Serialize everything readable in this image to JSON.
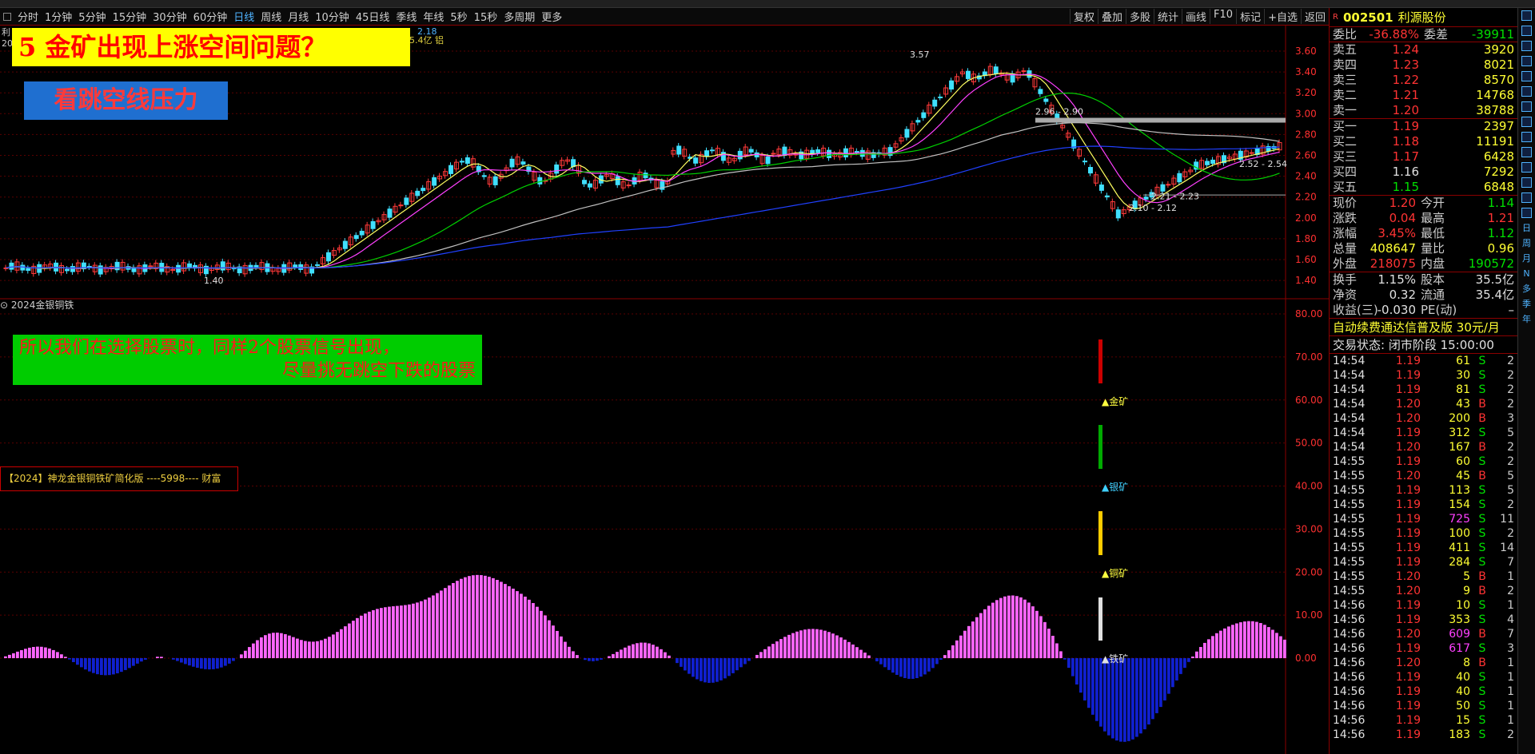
{
  "toolbar": {
    "items": [
      "分时",
      "1分钟",
      "5分钟",
      "15分钟",
      "30分钟",
      "60分钟",
      "日线",
      "周线",
      "月线",
      "10分钟",
      "45日线",
      "季线",
      "年线",
      "5秒",
      "15秒",
      "多周期",
      "更多"
    ],
    "active": "日线",
    "right": [
      "复权",
      "叠加",
      "多股",
      "统计",
      "画线",
      "F10",
      "标记",
      "+自选",
      "返回"
    ]
  },
  "chart": {
    "stock_short": "利",
    "date_short": "20",
    "price_ticks": [
      "3.60",
      "3.40",
      "3.20",
      "3.00",
      "2.80",
      "2.60",
      "2.40",
      "2.20",
      "2.00",
      "1.80",
      "1.60",
      "1.40"
    ],
    "annotations": [
      "3.57",
      "2.96 - 2.90",
      "2.52 - 2.54",
      "2.21 - 2.23",
      "2.10 - 2.12",
      "1.40"
    ],
    "ma_info": "5.4亿 铝",
    "ma_val": "2.18"
  },
  "overlays": {
    "title": "5 金矿出现上涨空间问题？",
    "gap": "看跳空线压力",
    "note_line1": "所以我们在选择股票时，同样2个股票信号出现，",
    "note_line2": "尽量挑无跳空下跌的股票"
  },
  "indicator": {
    "name": "2024金银铜铁",
    "label": "【2024】神龙金银铜铁矿简化版 ----5998---- 财富",
    "ticks": [
      "80.00",
      "70.00",
      "60.00",
      "50.00",
      "40.00",
      "30.00",
      "20.00",
      "10.00",
      "0.00"
    ],
    "signals": [
      "▲金矿",
      "▲银矿",
      "▲铜矿",
      "▲铁矿"
    ]
  },
  "quote": {
    "marker": "R",
    "code": "002501",
    "name": "利源股份",
    "weibi": {
      "label": "委比",
      "value": "-36.88%",
      "label2": "委差",
      "value2": "-39911"
    },
    "asks": [
      {
        "l": "卖五",
        "p": "1.24",
        "v": "3920"
      },
      {
        "l": "卖四",
        "p": "1.23",
        "v": "8021"
      },
      {
        "l": "卖三",
        "p": "1.22",
        "v": "8570"
      },
      {
        "l": "卖二",
        "p": "1.21",
        "v": "14768"
      },
      {
        "l": "卖一",
        "p": "1.20",
        "v": "38788"
      }
    ],
    "bids": [
      {
        "l": "买一",
        "p": "1.19",
        "v": "2397"
      },
      {
        "l": "买二",
        "p": "1.18",
        "v": "11191"
      },
      {
        "l": "买三",
        "p": "1.17",
        "v": "6428"
      },
      {
        "l": "买四",
        "p": "1.16",
        "v": "7292"
      },
      {
        "l": "买五",
        "p": "1.15",
        "v": "6848"
      }
    ],
    "stats": [
      {
        "a": "现价",
        "b": "1.20",
        "bc": "red",
        "c": "今开",
        "d": "1.14",
        "dc": "green"
      },
      {
        "a": "涨跌",
        "b": "0.04",
        "bc": "red",
        "c": "最高",
        "d": "1.21",
        "dc": "red"
      },
      {
        "a": "涨幅",
        "b": "3.45%",
        "bc": "red",
        "c": "最低",
        "d": "1.12",
        "dc": "green"
      },
      {
        "a": "总量",
        "b": "408647",
        "bc": "yellow",
        "c": "量比",
        "d": "0.96",
        "dc": "yellow"
      },
      {
        "a": "外盘",
        "b": "218075",
        "bc": "red",
        "c": "内盘",
        "d": "190572",
        "dc": "green"
      }
    ],
    "stats2": [
      {
        "a": "换手",
        "b": "1.15%",
        "bc": "white",
        "c": "股本",
        "d": "35.5亿",
        "dc": "white"
      },
      {
        "a": "净资",
        "b": "0.32",
        "bc": "white",
        "c": "流通",
        "d": "35.4亿",
        "dc": "white"
      },
      {
        "a": "收益(三)",
        "b": "-0.030",
        "bc": "white",
        "c": "PE(动)",
        "d": "–",
        "dc": "white"
      }
    ],
    "ad": "自动续费通达信普及版 30元/月",
    "status": "交易状态: 闭市阶段 15:00:00",
    "ticks": [
      {
        "t": "14:54",
        "p": "1.19",
        "v": "61",
        "s": "S",
        "n": "2"
      },
      {
        "t": "14:54",
        "p": "1.19",
        "v": "30",
        "s": "S",
        "n": "2"
      },
      {
        "t": "14:54",
        "p": "1.19",
        "v": "81",
        "s": "S",
        "n": "2"
      },
      {
        "t": "14:54",
        "p": "1.20",
        "v": "43",
        "s": "B",
        "n": "2"
      },
      {
        "t": "14:54",
        "p": "1.20",
        "v": "200",
        "s": "B",
        "n": "3"
      },
      {
        "t": "14:54",
        "p": "1.19",
        "v": "312",
        "s": "S",
        "n": "5"
      },
      {
        "t": "14:54",
        "p": "1.20",
        "v": "167",
        "s": "B",
        "n": "2"
      },
      {
        "t": "14:55",
        "p": "1.19",
        "v": "60",
        "s": "S",
        "n": "2"
      },
      {
        "t": "14:55",
        "p": "1.20",
        "v": "45",
        "s": "B",
        "n": "5"
      },
      {
        "t": "14:55",
        "p": "1.19",
        "v": "113",
        "s": "S",
        "n": "5"
      },
      {
        "t": "14:55",
        "p": "1.19",
        "v": "154",
        "s": "S",
        "n": "2"
      },
      {
        "t": "14:55",
        "p": "1.19",
        "v": "725",
        "s": "S",
        "n": "11"
      },
      {
        "t": "14:55",
        "p": "1.19",
        "v": "100",
        "s": "S",
        "n": "2"
      },
      {
        "t": "14:55",
        "p": "1.19",
        "v": "411",
        "s": "S",
        "n": "14"
      },
      {
        "t": "14:55",
        "p": "1.19",
        "v": "284",
        "s": "S",
        "n": "7"
      },
      {
        "t": "14:55",
        "p": "1.20",
        "v": "5",
        "s": "B",
        "n": "1"
      },
      {
        "t": "14:55",
        "p": "1.20",
        "v": "9",
        "s": "B",
        "n": "2"
      },
      {
        "t": "14:56",
        "p": "1.19",
        "v": "10",
        "s": "S",
        "n": "1"
      },
      {
        "t": "14:56",
        "p": "1.19",
        "v": "353",
        "s": "S",
        "n": "4"
      },
      {
        "t": "14:56",
        "p": "1.20",
        "v": "609",
        "s": "B",
        "n": "7"
      },
      {
        "t": "14:56",
        "p": "1.19",
        "v": "617",
        "s": "S",
        "n": "3"
      },
      {
        "t": "14:56",
        "p": "1.20",
        "v": "8",
        "s": "B",
        "n": "1"
      },
      {
        "t": "14:56",
        "p": "1.19",
        "v": "40",
        "s": "S",
        "n": "1"
      },
      {
        "t": "14:56",
        "p": "1.19",
        "v": "40",
        "s": "S",
        "n": "1"
      },
      {
        "t": "14:56",
        "p": "1.19",
        "v": "50",
        "s": "S",
        "n": "1"
      },
      {
        "t": "14:56",
        "p": "1.19",
        "v": "15",
        "s": "S",
        "n": "1"
      },
      {
        "t": "14:56",
        "p": "1.19",
        "v": "183",
        "s": "S",
        "n": "2"
      }
    ]
  },
  "sidebar": [
    "日",
    "周",
    "月",
    "N",
    "多",
    "季",
    "年"
  ]
}
